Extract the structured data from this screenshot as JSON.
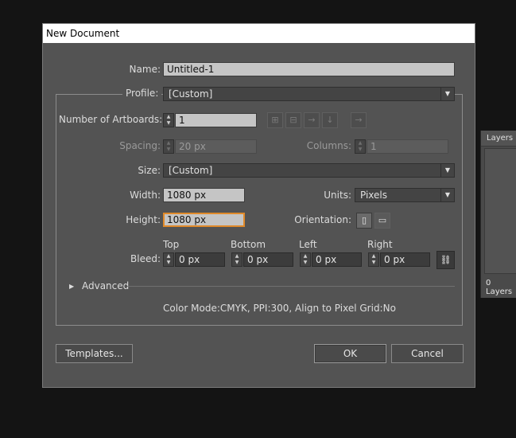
{
  "layers_panel": {
    "tab": "Layers",
    "count": "0 Layers"
  },
  "dialog": {
    "title": "New Document",
    "name": {
      "label": "Name:",
      "value": "Untitled-1"
    },
    "profile": {
      "label": "Profile:",
      "value": "[Custom]"
    },
    "artboards": {
      "label": "Number of Artboards:",
      "value": "1"
    },
    "spacing": {
      "label": "Spacing:",
      "value": "20 px"
    },
    "columns": {
      "label": "Columns:",
      "value": "1"
    },
    "size": {
      "label": "Size:",
      "value": "[Custom]"
    },
    "width": {
      "label": "Width:",
      "value": "1080 px"
    },
    "units": {
      "label": "Units:",
      "value": "Pixels"
    },
    "height": {
      "label": "Height:",
      "value": "1080 px"
    },
    "orientation": {
      "label": "Orientation:"
    },
    "bleed": {
      "label": "Bleed:",
      "top": {
        "label": "Top",
        "value": "0 px"
      },
      "bottom": {
        "label": "Bottom",
        "value": "0 px"
      },
      "left": {
        "label": "Left",
        "value": "0 px"
      },
      "right": {
        "label": "Right",
        "value": "0 px"
      }
    },
    "advanced": {
      "label": "Advanced"
    },
    "summary": "Color Mode:CMYK, PPI:300, Align to Pixel Grid:No",
    "buttons": {
      "templates": "Templates...",
      "ok": "OK",
      "cancel": "Cancel"
    }
  }
}
